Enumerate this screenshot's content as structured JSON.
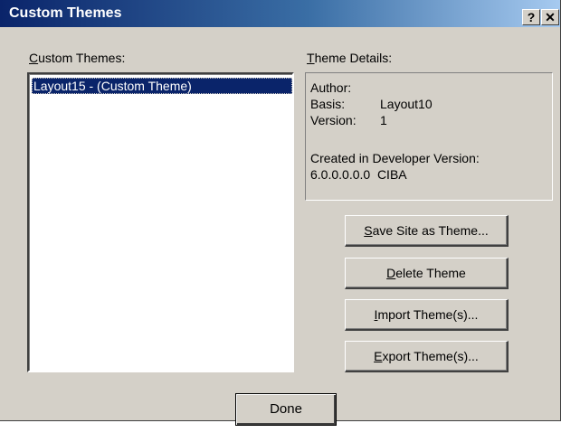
{
  "window": {
    "title": "Custom Themes",
    "help_label": "?",
    "close_label": "✕"
  },
  "list": {
    "label_hotkey": "C",
    "label_rest": "ustom Themes:",
    "items": [
      "Layout15 - (Custom Theme)"
    ],
    "selected_index": 0
  },
  "details": {
    "label_hotkey": "T",
    "label_rest": "heme Details:",
    "author_label": "Author:",
    "author_value": "",
    "basis_label": "Basis:",
    "basis_value": "Layout10",
    "version_label": "Version:",
    "version_value": "1",
    "created_label": "Created in Developer Version:",
    "created_value": "6.0.0.0.0.0  CIBA"
  },
  "buttons": {
    "save": {
      "hotkey": "S",
      "rest": "ave Site as Theme..."
    },
    "delete": {
      "hotkey": "D",
      "rest": "elete Theme"
    },
    "import": {
      "hotkey": "I",
      "rest": "mport Theme(s)..."
    },
    "export": {
      "hotkey": "E",
      "rest": "xport Theme(s)..."
    },
    "done": "Done"
  },
  "colors": {
    "dialog_bg": "#d4d0c8",
    "title_start": "#0a246a",
    "title_end": "#a6caf0",
    "selection": "#0a246a"
  }
}
